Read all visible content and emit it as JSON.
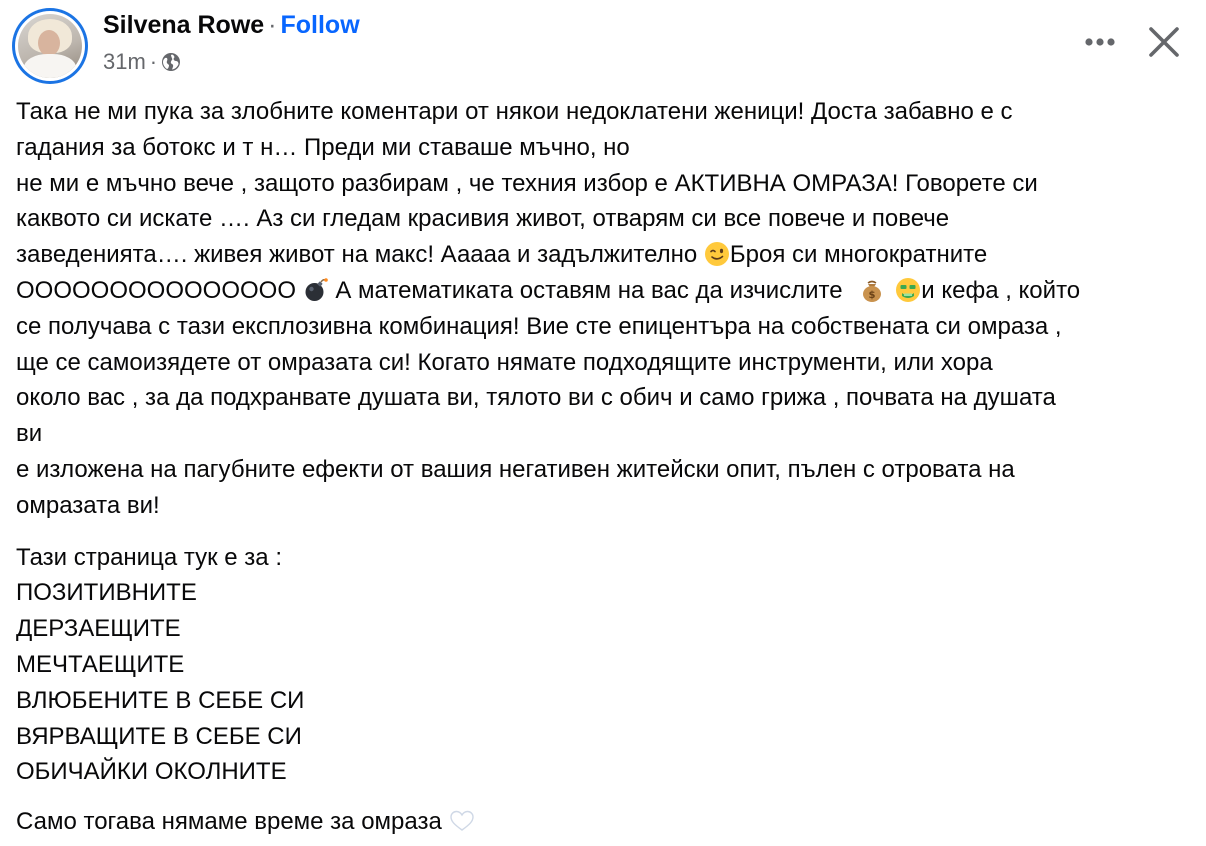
{
  "post": {
    "author_name": "Silvena Rowe",
    "separator": "·",
    "follow_label": "Follow",
    "timestamp": "31m",
    "meta_separator": "·",
    "privacy_icon": "globe-icon",
    "more_icon": "more-options-icon",
    "close_icon": "close-icon"
  },
  "body": {
    "p1": {
      "l1": "Така не ми пука за злобните коментари от някои недоклатени женици! Доста забавно е с",
      "l2": "гадания за ботокс и т н… Преди ми ставаше мъчно, но",
      "l3": "не ми е мъчно вече , защото разбирам , че техния избор е АКТИВНА ОМРАЗА! Говорете си",
      "l4": "каквото си искате …. Аз си гледам красивия живот, отварям си все повече и повече",
      "l5a": "заведенията…. живея живот на макс! Ааааа и задължително ",
      "l5b": "Броя си многократните",
      "l6a": "ООООООООООООООО ",
      "l6b": " А математиката оставям на вас да изчислите ",
      "l6c": "и кефа , който",
      "l7": "се получава с тази експлозивна комбинация! Вие сте епицентъра на собствената си омраза ,",
      "l8": "ще се самоизядете от омразата си! Когато нямате  подходящите инструменти, или хора",
      "l9": "около вас , за да подхранвате душата ви, тялото ви с обич и само грижа , почвата на  душата",
      "l10": "ви",
      "l11": "е изложена на пагубните ефекти от вашия негативен житейски опит, пълен с отровата на",
      "l12": "омразата ви!"
    },
    "p2": {
      "intro": "Тази страница тук е за :",
      "items": [
        "ПОЗИТИВНИТЕ",
        "ДЕРЗАЕЩИТЕ",
        "МЕЧТАЕЩИТЕ",
        "ВЛЮБЕНИТЕ В СЕБЕ СИ",
        "ВЯРВАЩИТЕ В СЕБЕ СИ",
        "ОБИЧАЙКИ ОКОЛНИТЕ"
      ]
    },
    "p3": {
      "text": "Само тогава нямаме време за омраза "
    },
    "emojis": {
      "wink": "winking-face-emoji",
      "bomb": "bomb-emoji",
      "money_bag": "money-bag-emoji",
      "money_face": "money-mouth-face-emoji",
      "heart": "white-heart-emoji"
    }
  },
  "colors": {
    "link": "#0866ff",
    "text": "#080809",
    "secondary": "#65676b",
    "avatar_ring": "#1b74e4"
  }
}
